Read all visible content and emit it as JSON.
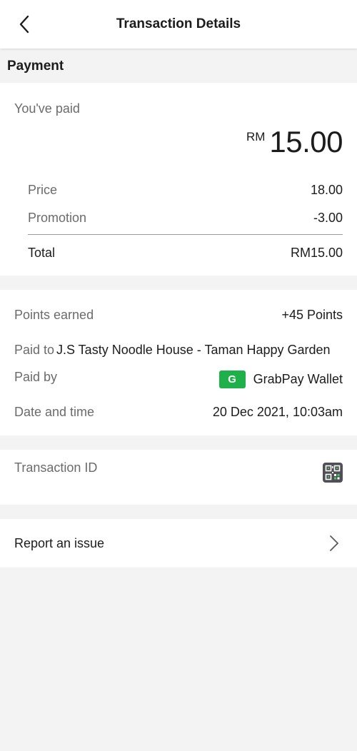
{
  "header": {
    "title": "Transaction Details",
    "back_icon": "chevron-left-icon"
  },
  "section": {
    "title": "Payment"
  },
  "payment": {
    "paid_label": "You've paid",
    "currency": "RM",
    "amount": "15.00",
    "rows": [
      {
        "label": "Price",
        "value": "18.00"
      },
      {
        "label": "Promotion",
        "value": "-3.00"
      }
    ],
    "total_label": "Total",
    "total_value": "RM15.00"
  },
  "details": {
    "points_label": "Points earned",
    "points_value": "+45 Points",
    "paid_to_label": "Paid to",
    "paid_to_value": "J.S Tasty Noodle House - Taman Happy Garden",
    "paid_by_label": "Paid by",
    "wallet_badge": "G",
    "wallet_name": "GrabPay Wallet",
    "wallet_color": "#1fb04a",
    "datetime_label": "Date and time",
    "datetime_value": "20 Dec 2021, 10:03am"
  },
  "transaction": {
    "id_label": "Transaction ID",
    "qr_icon": "qr-code-icon"
  },
  "report": {
    "label": "Report an issue",
    "chevron_icon": "chevron-right-icon"
  }
}
